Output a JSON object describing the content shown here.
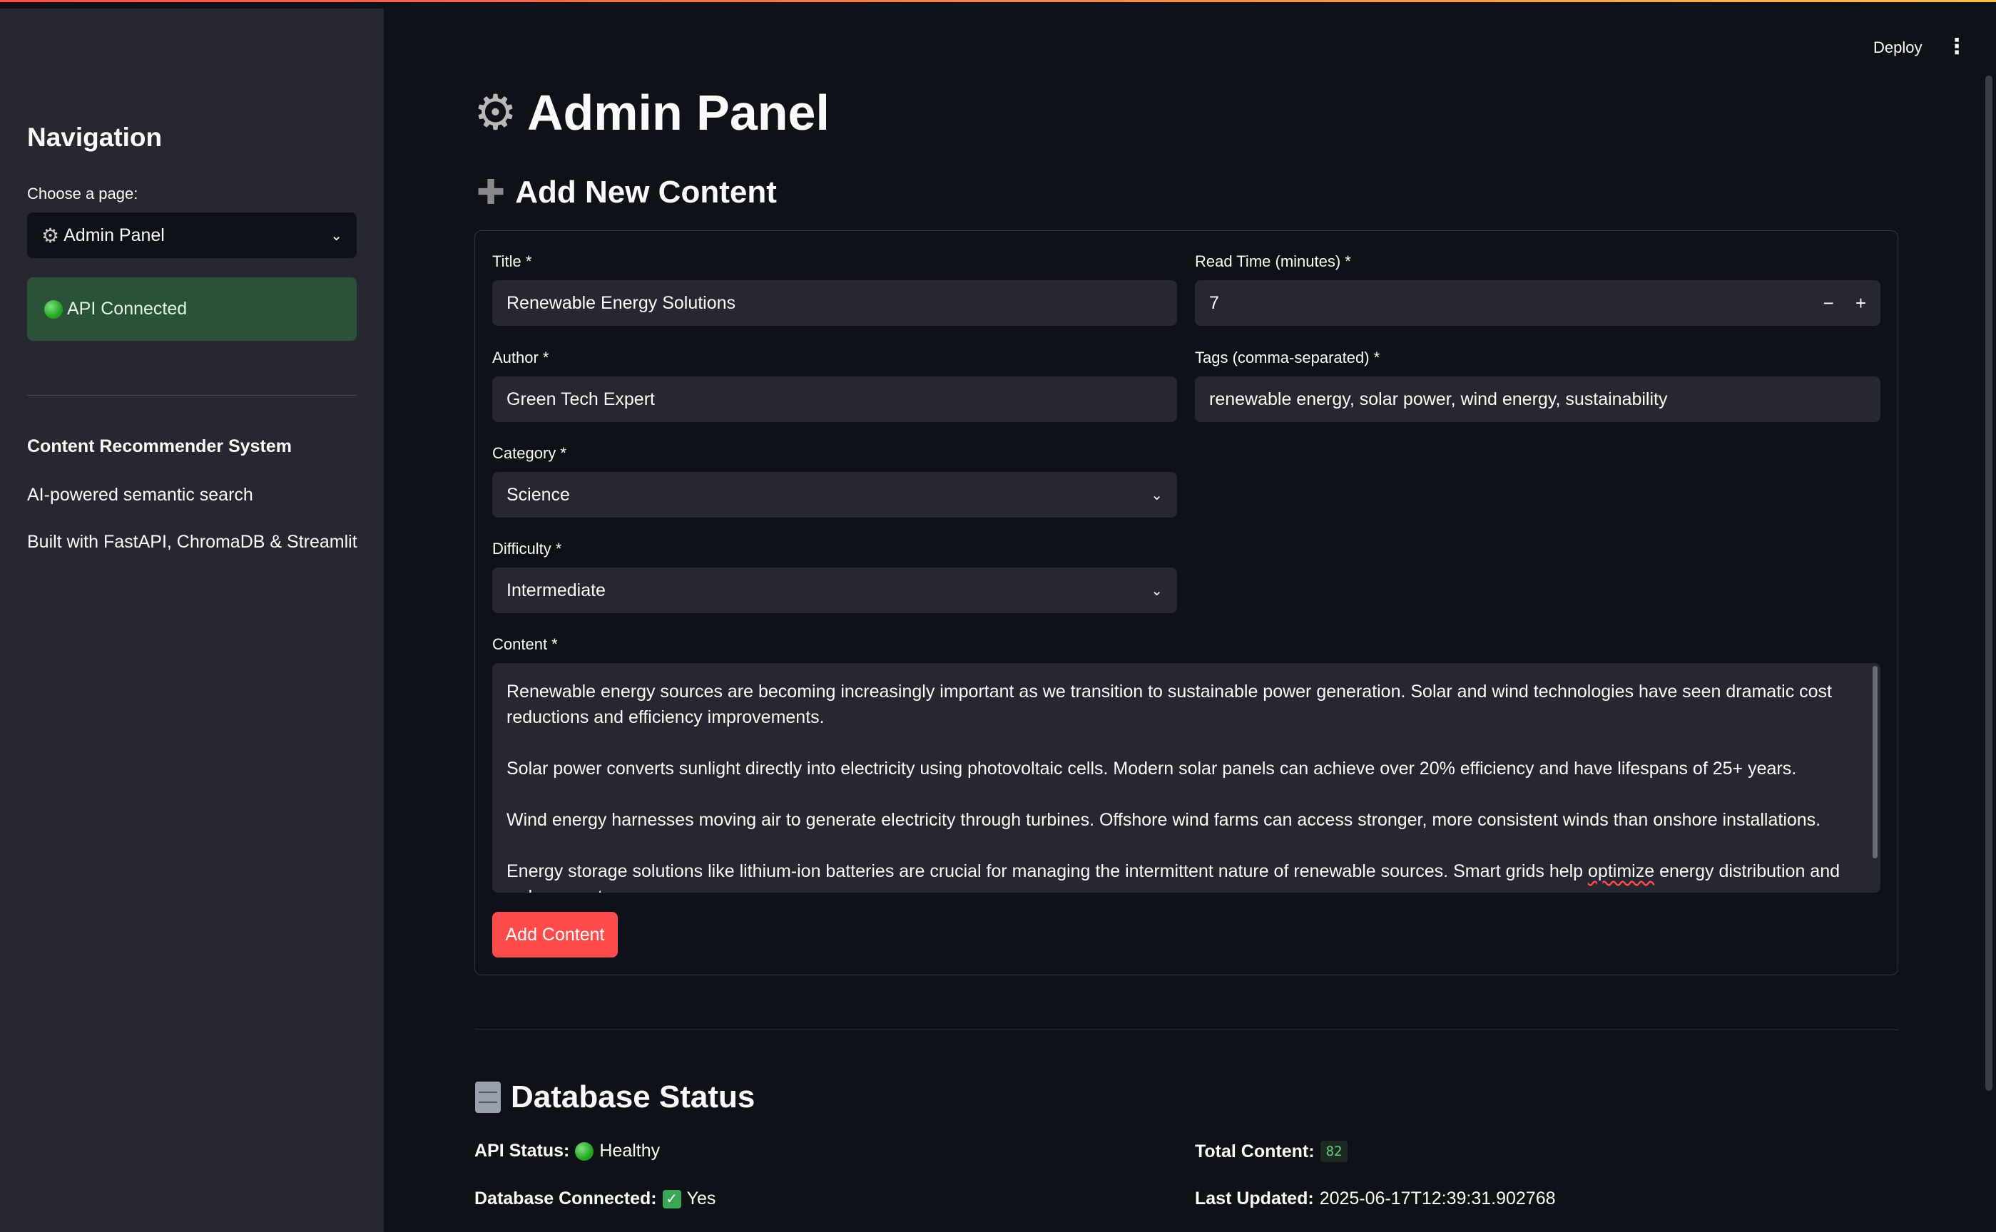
{
  "header": {
    "deploy_label": "Deploy",
    "menu_icon": "kebab-menu-icon"
  },
  "sidebar": {
    "heading": "Navigation",
    "select_label": "Choose a page:",
    "select_value": "Admin Panel",
    "status": "API Connected",
    "system_title": "Content Recommender System",
    "line1": "AI-powered semantic search",
    "line2": "Built with FastAPI, ChromaDB & Streamlit"
  },
  "main": {
    "title": "Admin Panel",
    "add_section_title": "Add New Content",
    "form": {
      "title_label": "Title *",
      "title_value": "Renewable Energy Solutions",
      "read_time_label": "Read Time (minutes) *",
      "read_time_value": "7",
      "minus": "−",
      "plus": "+",
      "author_label": "Author *",
      "author_value": "Green Tech Expert",
      "tags_label": "Tags (comma-separated) *",
      "tags_value": "renewable energy, solar power, wind energy, sustainability",
      "category_label": "Category *",
      "category_value": "Science",
      "difficulty_label": "Difficulty *",
      "difficulty_value": "Intermediate",
      "content_label": "Content *",
      "content_p1": "Renewable energy sources are becoming increasingly important as we transition to sustainable power generation. Solar and wind technologies have seen dramatic cost reductions and efficiency improvements.",
      "content_p2": "Solar power converts sunlight directly into electricity using photovoltaic cells. Modern solar panels can achieve over 20% efficiency and have lifespans of 25+ years.",
      "content_p3": "Wind energy harnesses moving air to generate electricity through turbines. Offshore wind farms can access stronger, more consistent winds than onshore installations.",
      "content_p4a": "Energy storage solutions like lithium-ion batteries are crucial for managing the intermittent nature of renewable sources. Smart grids help ",
      "content_p4b": "optimize",
      "content_p4c": " energy distribution and reduce waste.",
      "submit_label": "Add Content"
    },
    "db_section_title": "Database Status",
    "db": {
      "api_status_label": "API Status:",
      "api_status_value": "Healthy",
      "db_connected_label": "Database Connected:",
      "db_connected_value": "Yes",
      "total_label": "Total Content:",
      "total_value": "82",
      "updated_label": "Last Updated:",
      "updated_value": "2025-06-17T12:39:31.902768"
    }
  },
  "colors": {
    "accent": "#ff4b4b",
    "success_bg": "#2b5238",
    "sidebar_bg": "#262730",
    "app_bg": "#0e1117"
  }
}
